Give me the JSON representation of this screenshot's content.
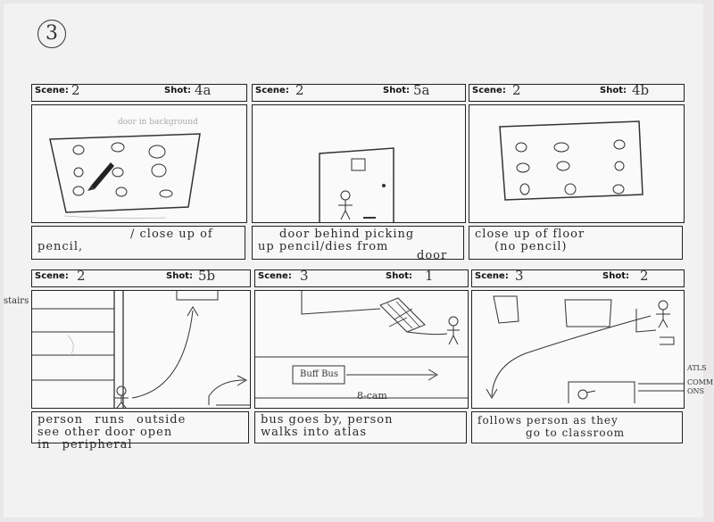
{
  "page_number": "3",
  "panels": [
    {
      "scene_label": "Scene:",
      "scene": "2",
      "shot_label": "Shot:",
      "shot": "4a",
      "caption": [
        "/ close up of",
        "pencil,"
      ]
    },
    {
      "scene_label": "Scene:",
      "scene": "2",
      "shot_label": "Shot:",
      "shot": "5a",
      "caption": [
        "door behind picking",
        "up pencil/dies from",
        "door"
      ]
    },
    {
      "scene_label": "Scene:",
      "scene": "2",
      "shot_label": "Shot:",
      "shot": "4b",
      "caption": [
        "close up of floor",
        "(no pencil)"
      ]
    },
    {
      "scene_label": "Scene:",
      "scene": "2",
      "shot_label": "Shot:",
      "shot": "5b",
      "caption": [
        "person runs outside",
        "see other door open",
        "in peripheral"
      ]
    },
    {
      "scene_label": "Scene:",
      "scene": "3",
      "shot_label": "Shot:",
      "shot": "1",
      "caption": [
        "bus goes by, person",
        "walks into atlas"
      ]
    },
    {
      "scene_label": "Scene:",
      "scene": "3",
      "shot_label": "Shot:",
      "shot": "2",
      "caption": [
        "follows person as they",
        "go to classroom"
      ]
    }
  ],
  "annotations": {
    "door_in_background": "door in background",
    "stairs": "stairs",
    "bus_sign": "Buff Bus",
    "cam": "8-cam",
    "atlas": "ATLS",
    "commons": "COMM ONS"
  }
}
